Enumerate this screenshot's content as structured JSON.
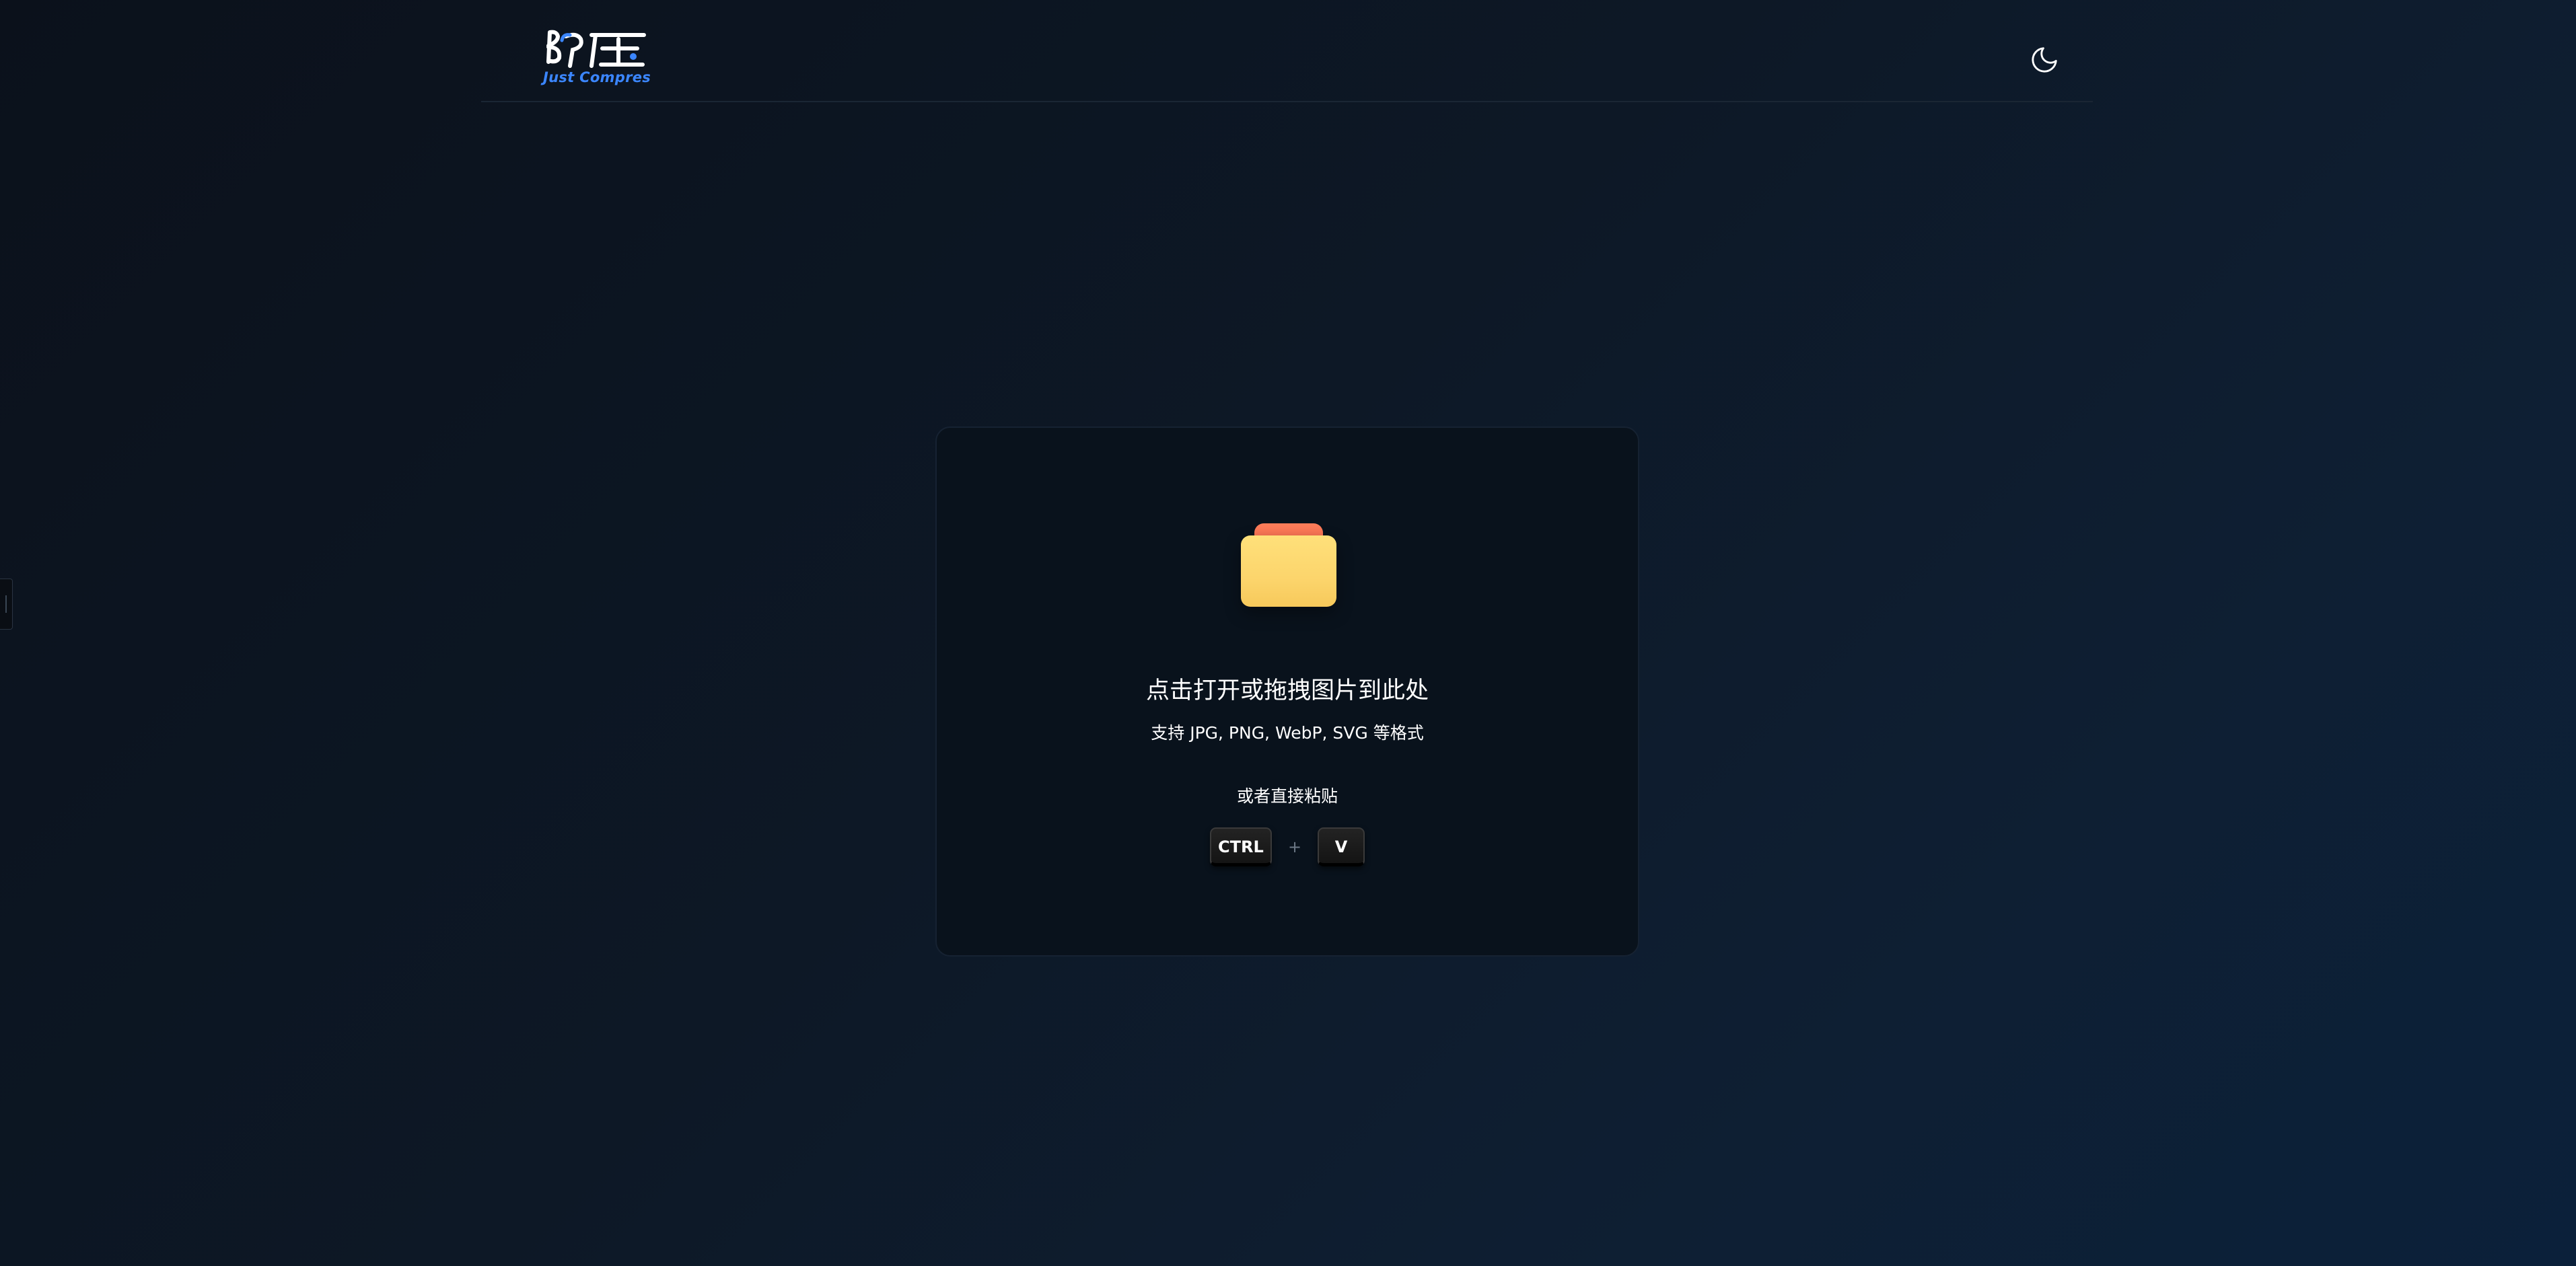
{
  "app": {
    "logo_mark": "即压",
    "logo_subtitle": "Just Compres",
    "accent_color": "#3b86ff"
  },
  "header": {
    "theme_toggle_icon": "moon-icon"
  },
  "dropzone": {
    "icon": "folder-icon",
    "title": "点击打开或拖拽图片到此处",
    "subtitle": "支持 JPG, PNG, WebP, SVG 等格式",
    "paste_label": "或者直接粘贴",
    "keys": {
      "ctrl": "CTRL",
      "plus": "+",
      "v": "V"
    }
  }
}
